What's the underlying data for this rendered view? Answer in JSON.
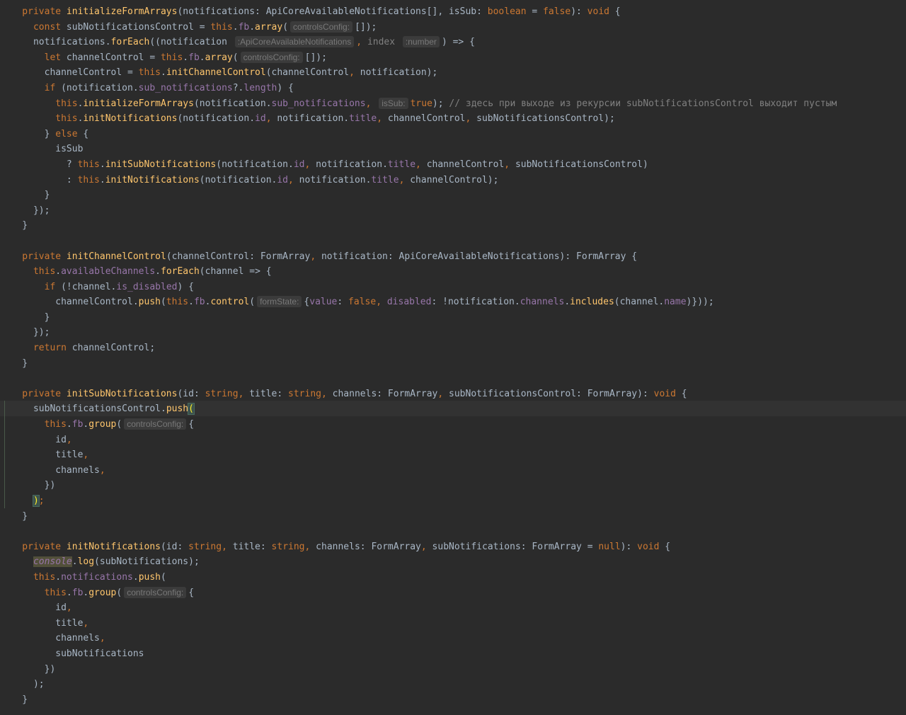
{
  "editor": {
    "lines": [
      [
        [
          "k",
          "    private "
        ],
        [
          "fn",
          "initializeFormArrays"
        ],
        [
          "p",
          "(notifications: ApiCoreAvailableNotifications[], isSub: "
        ],
        [
          "k",
          "boolean"
        ],
        [
          "p",
          " = "
        ],
        [
          "k",
          "false"
        ],
        [
          "p",
          "): "
        ],
        [
          "k",
          "void"
        ],
        [
          "p",
          " {"
        ]
      ],
      [
        [
          "k",
          "      const "
        ],
        [
          "p",
          "subNotificationsControl = "
        ],
        [
          "th",
          "this"
        ],
        [
          "p",
          "."
        ],
        [
          "pr",
          "fb"
        ],
        [
          "p",
          "."
        ],
        [
          "fn",
          "array"
        ],
        [
          "p",
          "("
        ],
        [
          "hint",
          "controlsConfig:"
        ],
        [
          "p",
          "[]);"
        ]
      ],
      [
        [
          "p",
          "      notifications."
        ],
        [
          "fn",
          "forEach"
        ],
        [
          "p",
          "((notification "
        ],
        [
          "hint",
          ":ApiCoreAvailableNotifications"
        ],
        [
          "pn",
          ", "
        ],
        [
          "cm",
          "index "
        ],
        [
          "hint",
          ":number"
        ],
        [
          "p",
          ") => {"
        ]
      ],
      [
        [
          "k",
          "        let "
        ],
        [
          "p",
          "channelControl = "
        ],
        [
          "th",
          "this"
        ],
        [
          "p",
          "."
        ],
        [
          "pr",
          "fb"
        ],
        [
          "p",
          "."
        ],
        [
          "fn",
          "array"
        ],
        [
          "p",
          "("
        ],
        [
          "hint",
          "controlsConfig:"
        ],
        [
          "p",
          "[]);"
        ]
      ],
      [
        [
          "p",
          "        channelControl = "
        ],
        [
          "th",
          "this"
        ],
        [
          "p",
          "."
        ],
        [
          "fn",
          "initChannelControl"
        ],
        [
          "p",
          "(channelControl"
        ],
        [
          "pn",
          ", "
        ],
        [
          "p",
          "notification);"
        ]
      ],
      [
        [
          "k",
          "        if "
        ],
        [
          "p",
          "(notification."
        ],
        [
          "pr",
          "sub_notifications"
        ],
        [
          "p",
          "?."
        ],
        [
          "pr",
          "length"
        ],
        [
          "p",
          ") {"
        ]
      ],
      [
        [
          "th",
          "          this"
        ],
        [
          "p",
          "."
        ],
        [
          "fn",
          "initializeFormArrays"
        ],
        [
          "p",
          "(notification."
        ],
        [
          "pr",
          "sub_notifications"
        ],
        [
          "pn",
          ", "
        ],
        [
          "hint",
          "isSub:"
        ],
        [
          "k",
          "true"
        ],
        [
          "p",
          ");"
        ],
        [
          "cm",
          " // здесь при выходе из рекурсии subNotificationsControl выходит пустым"
        ]
      ],
      [
        [
          "th",
          "          this"
        ],
        [
          "p",
          "."
        ],
        [
          "fn",
          "initNotifications"
        ],
        [
          "p",
          "(notification."
        ],
        [
          "pr",
          "id"
        ],
        [
          "pn",
          ", "
        ],
        [
          "p",
          "notification."
        ],
        [
          "pr",
          "title"
        ],
        [
          "pn",
          ", "
        ],
        [
          "p",
          "channelControl"
        ],
        [
          "pn",
          ", "
        ],
        [
          "p",
          "subNotificationsControl);"
        ]
      ],
      [
        [
          "p",
          "        } "
        ],
        [
          "k",
          "else "
        ],
        [
          "p",
          "{"
        ]
      ],
      [
        [
          "p",
          "          isSub"
        ]
      ],
      [
        [
          "p",
          "            ? "
        ],
        [
          "th",
          "this"
        ],
        [
          "p",
          "."
        ],
        [
          "fn",
          "initSubNotifications"
        ],
        [
          "p",
          "(notification."
        ],
        [
          "pr",
          "id"
        ],
        [
          "pn",
          ", "
        ],
        [
          "p",
          "notification."
        ],
        [
          "pr",
          "title"
        ],
        [
          "pn",
          ", "
        ],
        [
          "p",
          "channelControl"
        ],
        [
          "pn",
          ", "
        ],
        [
          "p",
          "subNotificationsControl)"
        ]
      ],
      [
        [
          "p",
          "            : "
        ],
        [
          "th",
          "this"
        ],
        [
          "p",
          "."
        ],
        [
          "fn",
          "initNotifications"
        ],
        [
          "p",
          "(notification."
        ],
        [
          "pr",
          "id"
        ],
        [
          "pn",
          ", "
        ],
        [
          "p",
          "notification."
        ],
        [
          "pr",
          "title"
        ],
        [
          "pn",
          ", "
        ],
        [
          "p",
          "channelControl);"
        ]
      ],
      [
        [
          "p",
          "        }"
        ]
      ],
      [
        [
          "p",
          "      });"
        ]
      ],
      [
        [
          "p",
          "    }"
        ]
      ],
      [
        [
          "p",
          ""
        ]
      ],
      [
        [
          "k",
          "    private "
        ],
        [
          "fn",
          "initChannelControl"
        ],
        [
          "p",
          "(channelControl: FormArray"
        ],
        [
          "pn",
          ", "
        ],
        [
          "p",
          "notification: ApiCoreAvailableNotifications): FormArray {"
        ]
      ],
      [
        [
          "th",
          "      this"
        ],
        [
          "p",
          "."
        ],
        [
          "pr",
          "availableChannels"
        ],
        [
          "p",
          "."
        ],
        [
          "fn",
          "forEach"
        ],
        [
          "p",
          "(channel => {"
        ]
      ],
      [
        [
          "k",
          "        if "
        ],
        [
          "p",
          "(!channel."
        ],
        [
          "pr",
          "is_disabled"
        ],
        [
          "p",
          ") {"
        ]
      ],
      [
        [
          "p",
          "          channelControl."
        ],
        [
          "fn",
          "push"
        ],
        [
          "p",
          "("
        ],
        [
          "th",
          "this"
        ],
        [
          "p",
          "."
        ],
        [
          "pr",
          "fb"
        ],
        [
          "p",
          "."
        ],
        [
          "fn",
          "control"
        ],
        [
          "p",
          "("
        ],
        [
          "hint",
          "formState:"
        ],
        [
          "p",
          "{"
        ],
        [
          "pr",
          "value"
        ],
        [
          "p",
          ": "
        ],
        [
          "k",
          "false"
        ],
        [
          "pn",
          ", "
        ],
        [
          "pr",
          "disabled"
        ],
        [
          "p",
          ": !notification."
        ],
        [
          "pr",
          "channels"
        ],
        [
          "p",
          "."
        ],
        [
          "fn",
          "includes"
        ],
        [
          "p",
          "(channel."
        ],
        [
          "pr",
          "name"
        ],
        [
          "p",
          ")}));"
        ]
      ],
      [
        [
          "p",
          "        }"
        ]
      ],
      [
        [
          "p",
          "      });"
        ]
      ],
      [
        [
          "k",
          "      return "
        ],
        [
          "p",
          "channelControl;"
        ]
      ],
      [
        [
          "p",
          "    }"
        ]
      ],
      [
        [
          "p",
          ""
        ]
      ],
      [
        [
          "k",
          "    private "
        ],
        [
          "fn",
          "initSubNotifications"
        ],
        [
          "p",
          "(id: "
        ],
        [
          "k",
          "string"
        ],
        [
          "pn",
          ", "
        ],
        [
          "p",
          "title: "
        ],
        [
          "k",
          "string"
        ],
        [
          "pn",
          ", "
        ],
        [
          "p",
          "channels: FormArray"
        ],
        [
          "pn",
          ", "
        ],
        [
          "p",
          "subNotificationsControl: FormArray): "
        ],
        [
          "k",
          "void"
        ],
        [
          "p",
          " {"
        ]
      ],
      [
        [
          "p",
          "      subNotificationsControl."
        ],
        [
          "fn",
          "push"
        ],
        [
          "bm",
          "("
        ]
      ],
      [
        [
          "th",
          "        this"
        ],
        [
          "p",
          "."
        ],
        [
          "pr",
          "fb"
        ],
        [
          "p",
          "."
        ],
        [
          "fn",
          "group"
        ],
        [
          "p",
          "("
        ],
        [
          "hint",
          "controlsConfig:"
        ],
        [
          "p",
          "{"
        ]
      ],
      [
        [
          "p",
          "          id"
        ],
        [
          "pn",
          ","
        ]
      ],
      [
        [
          "p",
          "          title"
        ],
        [
          "pn",
          ","
        ]
      ],
      [
        [
          "p",
          "          channels"
        ],
        [
          "pn",
          ","
        ]
      ],
      [
        [
          "p",
          "        })"
        ]
      ],
      [
        [
          "p",
          "      "
        ],
        [
          "bm",
          ")"
        ],
        [
          "pn",
          ";"
        ]
      ],
      [
        [
          "p",
          "    }"
        ]
      ],
      [
        [
          "p",
          ""
        ]
      ],
      [
        [
          "k",
          "    private "
        ],
        [
          "fn",
          "initNotifications"
        ],
        [
          "p",
          "(id: "
        ],
        [
          "k",
          "string"
        ],
        [
          "pn",
          ", "
        ],
        [
          "p",
          "title: "
        ],
        [
          "k",
          "string"
        ],
        [
          "pn",
          ", "
        ],
        [
          "p",
          "channels: FormArray"
        ],
        [
          "pn",
          ", "
        ],
        [
          "p",
          "subNotifications: FormArray = "
        ],
        [
          "k",
          "null"
        ],
        [
          "p",
          "): "
        ],
        [
          "k",
          "void"
        ],
        [
          "p",
          " {"
        ]
      ],
      [
        [
          "p",
          "      "
        ],
        [
          "warn",
          "console"
        ],
        [
          "p",
          "."
        ],
        [
          "fn",
          "log"
        ],
        [
          "p",
          "(subNotifications);"
        ]
      ],
      [
        [
          "th",
          "      this"
        ],
        [
          "p",
          "."
        ],
        [
          "pr",
          "notifications"
        ],
        [
          "p",
          "."
        ],
        [
          "fn",
          "push"
        ],
        [
          "p",
          "("
        ]
      ],
      [
        [
          "th",
          "        this"
        ],
        [
          "p",
          "."
        ],
        [
          "pr",
          "fb"
        ],
        [
          "p",
          "."
        ],
        [
          "fn",
          "group"
        ],
        [
          "p",
          "("
        ],
        [
          "hint",
          "controlsConfig:"
        ],
        [
          "p",
          "{"
        ]
      ],
      [
        [
          "p",
          "          id"
        ],
        [
          "pn",
          ","
        ]
      ],
      [
        [
          "p",
          "          title"
        ],
        [
          "pn",
          ","
        ]
      ],
      [
        [
          "p",
          "          channels"
        ],
        [
          "pn",
          ","
        ]
      ],
      [
        [
          "p",
          "          subNotifications"
        ]
      ],
      [
        [
          "p",
          "        })"
        ]
      ],
      [
        [
          "p",
          "      );"
        ]
      ],
      [
        [
          "p",
          "    }"
        ]
      ]
    ]
  }
}
